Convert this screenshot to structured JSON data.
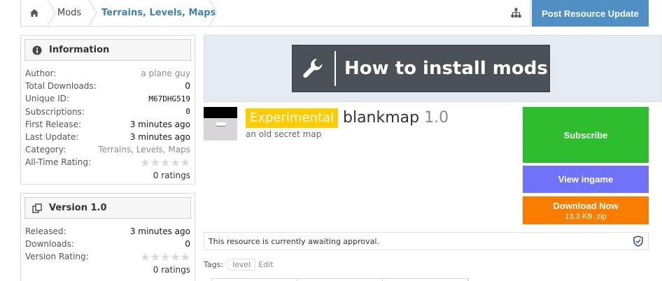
{
  "breadcrumb": {
    "home_icon": "home-icon",
    "mods": "Mods",
    "category": "Terrains, Levels, Maps",
    "sitemap_icon": "sitemap-icon"
  },
  "post_update_button": "Post Resource Update",
  "info_block": {
    "title": "Information",
    "rows": [
      {
        "label": "Author:",
        "value": "a plane guy"
      },
      {
        "label": "Total Downloads:",
        "value": "0"
      },
      {
        "label": "Unique ID:",
        "value": "M67DHG519"
      },
      {
        "label": "Subscriptions:",
        "value": "0"
      },
      {
        "label": "First Release:",
        "value": "3 minutes ago"
      },
      {
        "label": "Last Update:",
        "value": "3 minutes ago"
      },
      {
        "label": "Category:",
        "value": "Terrains, Levels, Maps"
      },
      {
        "label": "All-Time Rating:",
        "value": "0 of 5 stars"
      }
    ],
    "ratings_count": "0 ratings"
  },
  "version_block": {
    "title": "Version 1.0",
    "rows": [
      {
        "label": "Released:",
        "value": "3 minutes ago"
      },
      {
        "label": "Downloads:",
        "value": "0"
      },
      {
        "label": "Version Rating:",
        "value": "0 of 5 stars"
      }
    ],
    "ratings_count": "0 ratings"
  },
  "banner": {
    "text": "How to install mods",
    "icon": "wrench-icon"
  },
  "resource": {
    "badge": "Experimental",
    "title": "blankmap",
    "version": "1.0",
    "tagline": "an old secret map"
  },
  "actions": {
    "subscribe": "Subscribe",
    "ingame": "View ingame",
    "download": "Download Now",
    "download_size": "13.3 KB .zip"
  },
  "approval": {
    "text": "This resource is currently awaiting approval.",
    "icon": "shield-check-icon"
  },
  "tags": {
    "label": "Tags:",
    "items": [
      "level"
    ],
    "edit": "Edit"
  },
  "colors": {
    "post_button": "#4f8fc4",
    "badge": "#ffcc00",
    "subscribe": "#2ebd2e",
    "ingame": "#7072f7",
    "download": "#f87d00",
    "banner": "#4c5057",
    "link": "#3d81b0"
  }
}
